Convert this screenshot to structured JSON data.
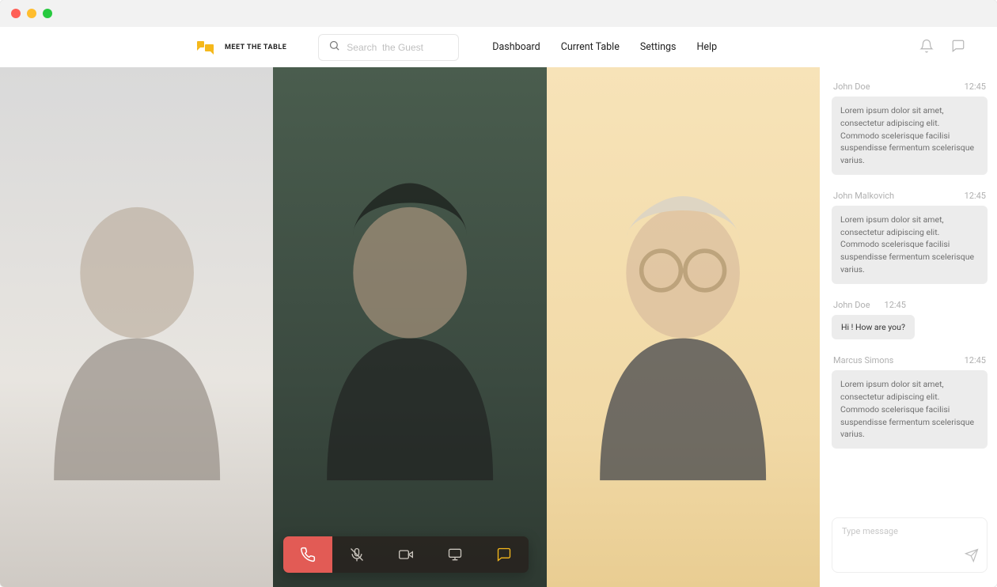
{
  "brand": {
    "name": "MEET THE TABLE"
  },
  "search": {
    "placeholder": "Search  the Guest"
  },
  "nav": {
    "items": [
      {
        "label": "Dashboard"
      },
      {
        "label": "Current Table"
      },
      {
        "label": "Settings"
      },
      {
        "label": "Help"
      }
    ]
  },
  "controls": {
    "hangup": "hangup",
    "mic": "mic-muted",
    "video": "video",
    "screen": "screen-share",
    "chat": "chat"
  },
  "chat": {
    "messages": [
      {
        "name": "John Doe",
        "time": "12:45",
        "type": "long",
        "text": "Lorem ipsum dolor sit amet, consectetur adipiscing elit. Commodo scelerisque facilisi suspendisse fermentum scelerisque varius."
      },
      {
        "name": "John Malkovich",
        "time": "12:45",
        "type": "long",
        "text": "Lorem ipsum dolor sit amet, consectetur adipiscing elit. Commodo scelerisque facilisi suspendisse fermentum scelerisque varius."
      },
      {
        "name": "John Doe",
        "time": "12:45",
        "type": "short",
        "text": "Hi ! How are you?"
      },
      {
        "name": "Marcus Simons",
        "time": "12:45",
        "type": "long",
        "text": "Lorem ipsum dolor sit amet, consectetur adipiscing elit. Commodo scelerisque facilisi suspendisse fermentum scelerisque varius."
      }
    ],
    "input_placeholder": "Type message"
  },
  "colors": {
    "accent": "#f5b81b",
    "danger": "#e25b55",
    "control_bg": "#2a2622"
  }
}
